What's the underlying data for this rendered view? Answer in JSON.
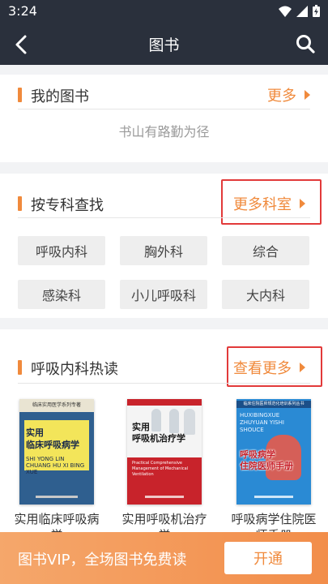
{
  "status_bar": {
    "time": "3:24"
  },
  "nav": {
    "title": "图书"
  },
  "my_books": {
    "title": "我的图书",
    "more_label": "更多",
    "motto": "书山有路勤为径"
  },
  "by_department": {
    "title": "按专科查找",
    "more_label": "更多科室",
    "departments": [
      "呼吸内科",
      "胸外科",
      "综合",
      "感染科",
      "小儿呼吸科",
      "大内科"
    ]
  },
  "hot_reads": {
    "title": "呼吸内科热读",
    "more_label": "查看更多",
    "books": [
      {
        "title": "实用临床呼吸病学",
        "cover_top_text": "临床实用医学系列专著",
        "cover_main": "实用\n临床呼吸病学",
        "cover_pinyin": "SHI YONG LIN CHUANG HU XI BING XUE",
        "cover_color": "#2f5f8f"
      },
      {
        "title": "实用呼吸机治疗学",
        "cover_top_text": "",
        "cover_main": "实用\n呼吸机治疗学",
        "cover_pinyin": "Practical Comprehensive Management of Mechanical Ventilation",
        "cover_color": "#c8232b"
      },
      {
        "title": "呼吸病学住院医师手册",
        "cover_top_text": "临床住院医师规范化培训系列丛书",
        "cover_main": "呼吸病学\n住院医师手册",
        "cover_pinyin": "HUXIBINGXUE ZHUYUAN YISHI SHOUCE",
        "cover_color": "#2a8ad4"
      }
    ]
  },
  "vip_banner": {
    "text": "图书VIP，全场图书免费读",
    "button_label": "开通"
  },
  "colors": {
    "accent": "#f08a3c",
    "nav_bg": "#2a303c",
    "highlight_box": "#e23a3a"
  }
}
